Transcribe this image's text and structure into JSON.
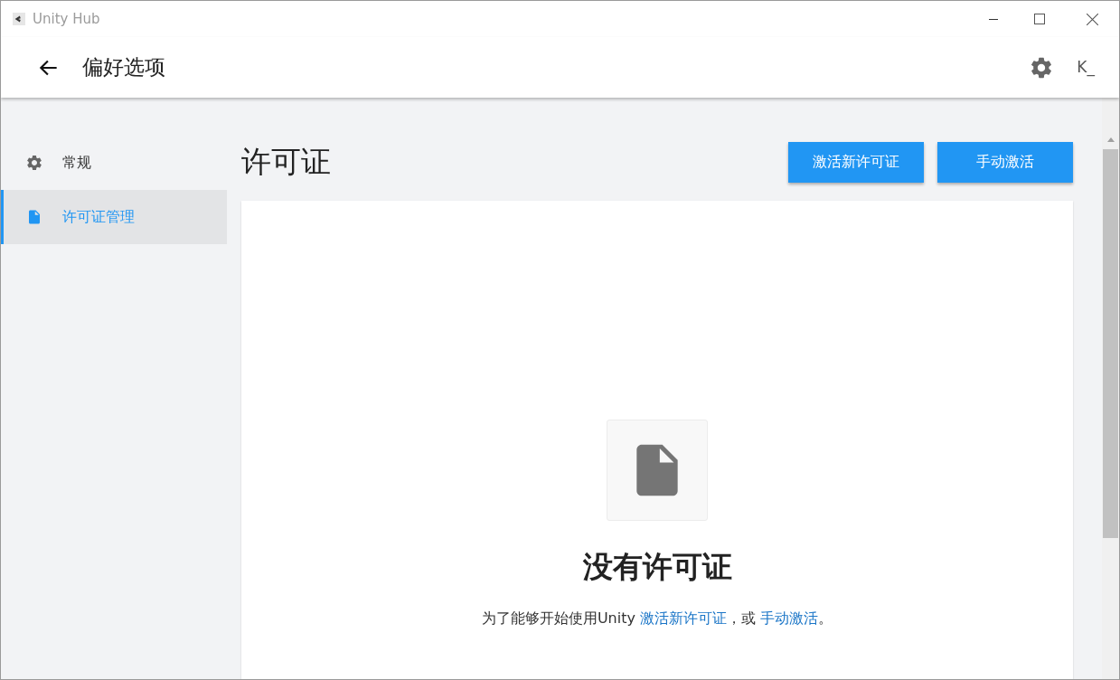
{
  "window": {
    "title": "Unity Hub"
  },
  "header": {
    "title": "偏好选项",
    "account": "K_"
  },
  "sidebar": {
    "items": [
      {
        "label": "常规",
        "kind": "gear",
        "selected": false
      },
      {
        "label": "许可证管理",
        "kind": "file",
        "selected": true
      }
    ]
  },
  "page": {
    "title": "许可证",
    "buttons": [
      "激活新许可证",
      "手动激活"
    ]
  },
  "empty_state": {
    "title": "没有许可证",
    "message": [
      {
        "kind": "text",
        "text": "为了能够开始使用Unity "
      },
      {
        "kind": "link",
        "text": "激活新许可证"
      },
      {
        "kind": "text",
        "text": "，或 "
      },
      {
        "kind": "link",
        "text": "手动激活"
      },
      {
        "kind": "text",
        "text": "。"
      }
    ]
  }
}
